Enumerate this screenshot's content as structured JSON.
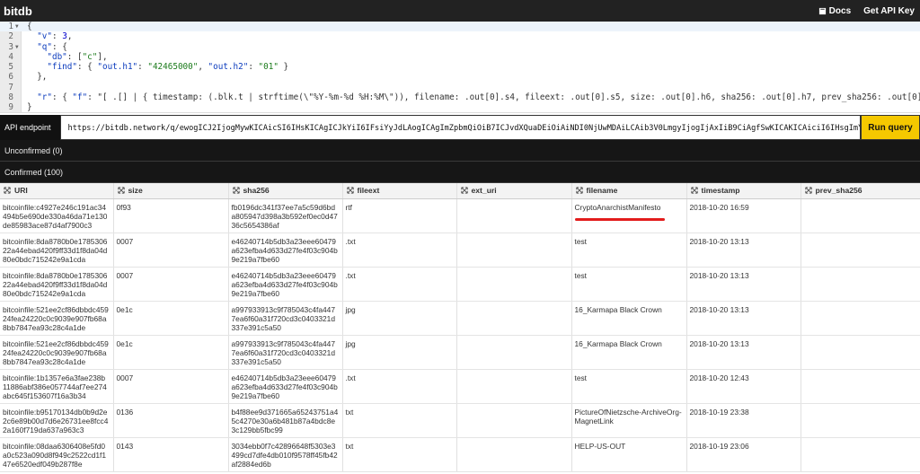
{
  "topbar": {
    "brand": "bitdb",
    "docs_label": "Docs",
    "api_key_label": "Get API Key"
  },
  "editor": {
    "lines": [
      {
        "n": "1",
        "fold": true,
        "code": "{"
      },
      {
        "n": "2",
        "fold": false,
        "code": "  \"v\": 3,"
      },
      {
        "n": "3",
        "fold": true,
        "code": "  \"q\": {"
      },
      {
        "n": "4",
        "fold": false,
        "code": "    \"db\": [\"c\"],"
      },
      {
        "n": "5",
        "fold": false,
        "code": "    \"find\": { \"out.h1\": \"42465000\", \"out.h2\": \"01\" }"
      },
      {
        "n": "6",
        "fold": false,
        "code": "  },"
      },
      {
        "n": "7",
        "fold": false,
        "code": ""
      },
      {
        "n": "8",
        "fold": false,
        "code": "  \"r\": { \"f\": \"[ .[] | { timestamp: (.blk.t | strftime(\\\"%Y-%m-%d %H:%M\\\")), filename: .out[0].s4, fileext: .out[0].s5, size: .out[0].h6, sha256: .out[0].h7, prev_sha256: .out[0].h8, ext_uri:"
      },
      {
        "n": "9",
        "fold": false,
        "code": "}"
      }
    ]
  },
  "api": {
    "label": "API endpoint",
    "url": "https://bitdb.network/q/ewogICJ2IjogMywKICAicSI6IHsKICAgICJkYiI6IFsiYyJdLAogICAgImZpbmQiOiB7ICJvdXQuaDEiOiAiNDI0NjUwMDAiLCAib3V0LmgyIjogIjAxIiB9CiAgfSwKICAKICAiciI6IHsgImYiOiAiWyAuW10gfCB7",
    "run_label": "Run query"
  },
  "sections": {
    "unconfirmed": "Unconfirmed (0)",
    "confirmed": "Confirmed (100)"
  },
  "table": {
    "columns": [
      "URI",
      "size",
      "sha256",
      "fileext",
      "ext_uri",
      "filename",
      "timestamp",
      "prev_sha256"
    ],
    "rows": [
      {
        "uri": "bitcoinfile:c4927e246c191ac34494b5e690de330a46da71e130de85983ace87d4af7900c3",
        "size": "0f93",
        "sha256": "fb0196dc341f37ee7a5c59d6bda805947d398a3b592ef0ec0d4736c5654386af",
        "fileext": "rtf",
        "ext_uri": "",
        "filename": "CryptoAnarchistManifesto",
        "timestamp": "2018-10-20 16:59",
        "prev_sha256": ""
      },
      {
        "uri": "bitcoinfile:8da8780b0e178530622a44ebad420f9ff33d1f8da04d80e0bdc715242e9a1cda",
        "size": "0007",
        "sha256": "e46240714b5db3a23eee60479a623efba4d633d27fe4f03c904b9e219a7fbe60",
        "fileext": ".txt",
        "ext_uri": "",
        "filename": "test",
        "timestamp": "2018-10-20 13:13",
        "prev_sha256": ""
      },
      {
        "uri": "bitcoinfile:8da8780b0e178530622a44ebad420f9ff33d1f8da04d80e0bdc715242e9a1cda",
        "size": "0007",
        "sha256": "e46240714b5db3a23eee60479a623efba4d633d27fe4f03c904b9e219a7fbe60",
        "fileext": ".txt",
        "ext_uri": "",
        "filename": "test",
        "timestamp": "2018-10-20 13:13",
        "prev_sha256": ""
      },
      {
        "uri": "bitcoinfile:521ee2cf86dbbdc45924fea24220c0c9039e907fb68a8bb7847ea93c28c4a1de",
        "size": "0e1c",
        "sha256": "a997933913c9f785043c4fa4477ea6f60a31f720cd3c0403321d337e391c5a50",
        "fileext": "jpg",
        "ext_uri": "",
        "filename": "16_Karmapa Black Crown",
        "timestamp": "2018-10-20 13:13",
        "prev_sha256": ""
      },
      {
        "uri": "bitcoinfile:521ee2cf86dbbdc45924fea24220c0c9039e907fb68a8bb7847ea93c28c4a1de",
        "size": "0e1c",
        "sha256": "a997933913c9f785043c4fa4477ea6f60a31f720cd3c0403321d337e391c5a50",
        "fileext": "jpg",
        "ext_uri": "",
        "filename": "16_Karmapa Black Crown",
        "timestamp": "2018-10-20 13:13",
        "prev_sha256": ""
      },
      {
        "uri": "bitcoinfile:1b1357e6a3fae238b11886abf386e057744af7ee274abc645f153607f16a3b34",
        "size": "0007",
        "sha256": "e46240714b5db3a23eee60479a623efba4d633d27fe4f03c904b9e219a7fbe60",
        "fileext": ".txt",
        "ext_uri": "",
        "filename": "test",
        "timestamp": "2018-10-20 12:43",
        "prev_sha256": ""
      },
      {
        "uri": "bitcoinfile:b95170134db0b9d2e2c6e89b00d7d6e26731ee8fcc42a160f719da637a963c3",
        "size": "0136",
        "sha256": "b4f88ee9d371665a65243751a45c4270e30a6b481b87a4bdc8e3c129bb5fbc99",
        "fileext": "txt",
        "ext_uri": "",
        "filename": "PictureOfNietzsche-ArchiveOrg-MagnetLink",
        "timestamp": "2018-10-19 23:38",
        "prev_sha256": ""
      },
      {
        "uri": "bitcoinfile:08daa6306408e5fd0a0c523a090d8f949c2522cd1f147e6520edf049b287f8e",
        "size": "0143",
        "sha256": "3034ebb0f7c42896648f5303e3499cd7dfe4db010f9578ff45fb42af2884ed6b",
        "fileext": "txt",
        "ext_uri": "",
        "filename": "HELP-US-OUT",
        "timestamp": "2018-10-19 23:06",
        "prev_sha256": ""
      }
    ]
  },
  "colors": {
    "accent": "#f5c800",
    "highlight": "#e21c1c"
  }
}
